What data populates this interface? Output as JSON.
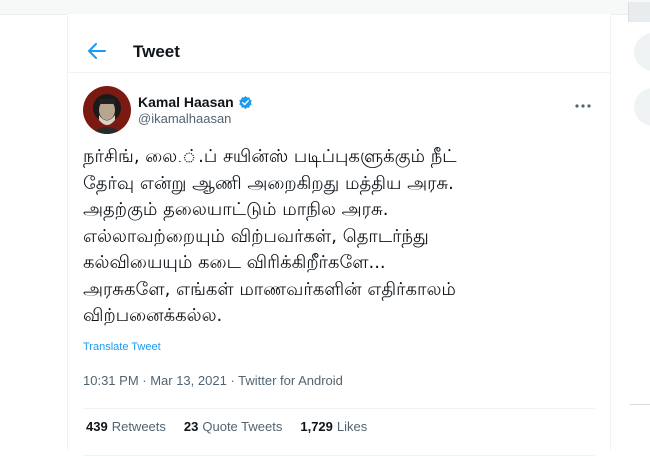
{
  "header": {
    "title": "Tweet",
    "back_icon": "arrow-left-icon"
  },
  "tweet": {
    "author": {
      "name": "Kamal Haasan",
      "handle": "@ikamalhaasan",
      "verified": true,
      "verified_color": "#1d9bf0"
    },
    "text_lines": [
      "நர்சிங், லை.்.ப் சயின்ஸ் படிப்புகளுக்கும் நீட்",
      "தேர்வு என்று ஆணி அறைகிறது மத்திய அரசு.",
      "அதற்கும் தலையாட்டும் மாநில அரசு.",
      "எல்லாவற்றையும் விற்பவர்கள், தொடர்ந்து",
      "கல்வியையும் கடை விரிக்கிறீர்களே...",
      "அரசுகளே, எங்கள் மாணவர்களின் எதிர்காலம்",
      "விற்பனைக்கல்ல."
    ],
    "translate_label": "Translate Tweet",
    "timestamp": "10:31 PM · Mar 13, 2021 · Twitter for Android",
    "stats": {
      "retweets_count": "439",
      "retweets_label": "Retweets",
      "quotes_count": "23",
      "quotes_label": "Quote Tweets",
      "likes_count": "1,729",
      "likes_label": "Likes"
    }
  },
  "colors": {
    "accent": "#1d9bf0",
    "text_primary": "#0f1419",
    "text_secondary": "#536471"
  }
}
